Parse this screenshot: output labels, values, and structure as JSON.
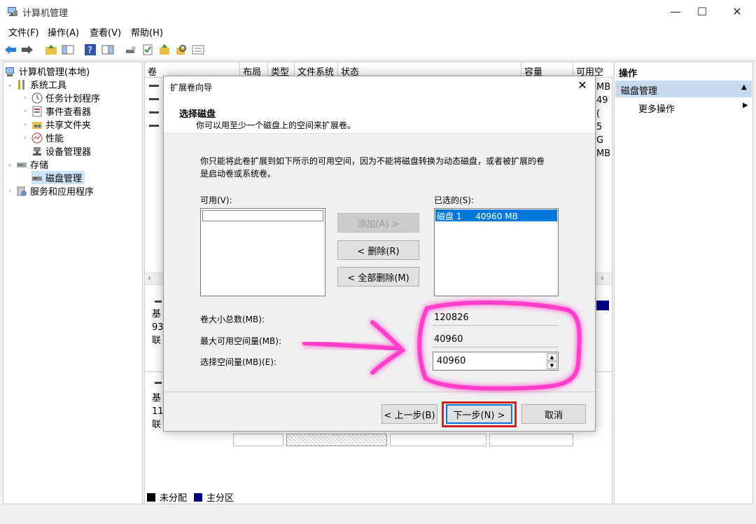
{
  "window": {
    "title": "计算机管理",
    "minimize": "—",
    "maximize": "☐",
    "close": "✕"
  },
  "menu": [
    "文件(F)",
    "操作(A)",
    "查看(V)",
    "帮助(H)"
  ],
  "tree": {
    "root": "计算机管理(本地)",
    "system_tools": "系统工具",
    "task_scheduler": "任务计划程序",
    "event_viewer": "事件查看器",
    "shared_folders": "共享文件夹",
    "performance": "性能",
    "device_manager": "设备管理器",
    "storage": "存储",
    "disk_management": "磁盘管理",
    "services": "服务和应用程序"
  },
  "volume_list": {
    "columns": [
      "卷",
      "布局",
      "类型",
      "文件系统",
      "状态",
      "容量",
      "可用空间"
    ],
    "free_fragments": [
      "MB",
      "49 (",
      "5 G",
      "MB"
    ],
    "disk_rows": [
      [
        "基",
        "93",
        "联"
      ],
      [
        "基",
        "11",
        "联"
      ]
    ]
  },
  "legend": {
    "unallocated": "未分配",
    "primary": "主分区"
  },
  "actions": {
    "header": "操作",
    "section": "磁盘管理",
    "more": "更多操作"
  },
  "dialog": {
    "title": "扩展卷向导",
    "heading": "选择磁盘",
    "subheading": "你可以用至少一个磁盘上的空间来扩展卷。",
    "description_line1": "你只能将此卷扩展到如下所示的可用空间，因为不能将磁盘转换为动态磁盘，或者被扩展的卷",
    "description_line2": "是启动卷或系统卷。",
    "available_label": "可用(V):",
    "selected_label": "已选的(S):",
    "add_button": "添加(A) >",
    "remove_button": "< 删除(R)",
    "remove_all_button": "< 全部删除(M)",
    "selected_items": [
      {
        "disk": "磁盘 1",
        "size": "40960 MB"
      }
    ],
    "total_size_label": "卷大小总数(MB):",
    "total_size_value": "120826",
    "max_space_label": "最大可用空间量(MB):",
    "max_space_value": "40960",
    "select_space_label": "选择空间量(MB)(E):",
    "select_space_value": "40960",
    "back_button": "< 上一步(B)",
    "next_button": "下一步(N) >",
    "cancel_button": "取消"
  },
  "colors": {
    "highlight": "#ff3cc8",
    "next_outline": "#d32020",
    "selection": "#0078d7",
    "primary_partition": "#000080"
  }
}
